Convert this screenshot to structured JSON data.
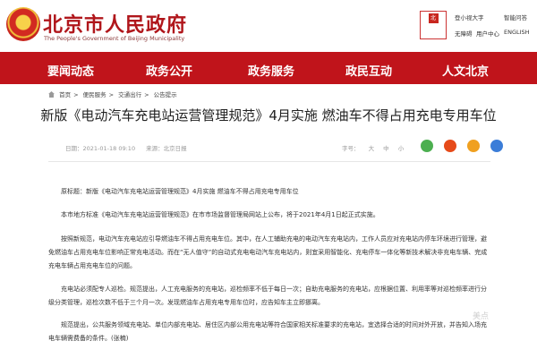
{
  "header": {
    "site_title": "北京市人民政府",
    "site_subtitle": "The People's Government of Beijing Municipality",
    "logo_text": "北京",
    "top_links": {
      "accessibility": "登小视大字",
      "smart_q": "智能问答",
      "accessible": "无障碍",
      "user_center": "用户中心",
      "english": "ENGLISH"
    }
  },
  "nav": {
    "items": [
      "要闻动态",
      "政务公开",
      "政务服务",
      "政民互动",
      "人文北京"
    ]
  },
  "breadcrumb": [
    "首页",
    "便民服务",
    "交通出行",
    "公告提示"
  ],
  "article": {
    "title": "新版《电动汽车充电站运营管理规范》4月实施 燃油车不得占用充电专用车位",
    "date": "日期：2021-01-18 09:10",
    "source": "来源：北京日报",
    "font_label": "字号：",
    "font_large": "大",
    "font_medium": "中",
    "font_small": "小",
    "p1": "原标题：新版《电动汽车充电站运营管理规范》4月实施 燃油车不得占用充电专用车位",
    "p2": "本市地方标准《电动汽车充电站运营管理规范》在市市场监督管理局网站上公布，将于2021年4月1日起正式实施。",
    "p3": "按照新规范，电动汽车充电站应引导燃油车不得占用充电车位。其中，在人工辅助充电的电动汽车充电站内，工作人员应对充电站内停车环境进行管理，避免燃油车占用充电车位影响正常充电活动。而在“无人值守”的自动式充电电动汽车充电站内，则宜采用智能化、充电停车一体化等新技术解决非充电车辆、完成充电车辆占用充电车位的问题。",
    "p4": "充电站必须配专人巡检。规范提出，人工充电服务的充电站，巡检频率不低于每日一次；自助充电服务的充电站，应根据位置、利用率等对巡检频率进行分级分类管理，巡检次数不低于三个月一次。发现燃油车占用充电专用车位时，应告知车主立即挪离。",
    "p5": "规范提出，公共服务领域充电站、单位内部充电站、居住区内部公用充电站等符合国家相关标准要求的充电站，宜选择合适的时间对外开放，并告知入场充电车辆需费备的条件。(张楠)"
  },
  "watermark": "美点",
  "colors": {
    "brand_red": "#c0141b",
    "title_red": "#b0161b",
    "wechat": "#4caf50",
    "weibo": "#e64a19",
    "qzone": "#f0a020",
    "share_blue": "#3b7dd8"
  }
}
